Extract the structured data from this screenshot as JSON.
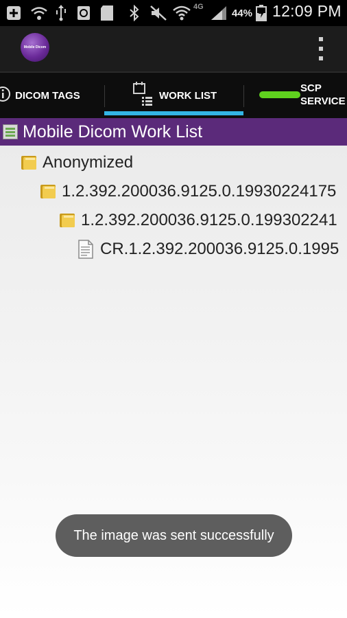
{
  "status_bar": {
    "network_badge": "4G",
    "battery_percent": "44%",
    "time": "12:09 PM"
  },
  "action_bar": {
    "logo_text": "Mobile Dicom"
  },
  "tabs": [
    {
      "label": "DICOM TAGS",
      "icon": "info-icon",
      "selected": false
    },
    {
      "label": "WORK LIST",
      "icon": "calendar-list-icon",
      "selected": true
    },
    {
      "label_line1": "SCP",
      "label_line2": "SERVICE",
      "icon": "toggle-switch-icon",
      "selected": false
    }
  ],
  "tree": {
    "header_title": "Mobile Dicom Work List",
    "items": [
      {
        "label": "Anonymized",
        "icon": "folder-icon",
        "depth": 1
      },
      {
        "label": "1.2.392.200036.9125.0.19930224175",
        "icon": "folder-icon",
        "depth": 2
      },
      {
        "label": "1.2.392.200036.9125.0.199302241",
        "icon": "folder-icon",
        "depth": 3
      },
      {
        "label": "CR.1.2.392.200036.9125.0.1995",
        "icon": "file-icon",
        "depth": 4
      }
    ]
  },
  "toast": {
    "message": "The image was sent successfully"
  },
  "colors": {
    "status_bar_bg": "#000000",
    "action_bar_bg": "#1c1c1c",
    "tab_bar_bg": "#0d0d0d",
    "tab_indicator": "#33b5e5",
    "tree_header_bg": "#5b2a7a",
    "scp_toggle_green": "#5fd11e",
    "toast_bg": "#5e5e5e"
  }
}
